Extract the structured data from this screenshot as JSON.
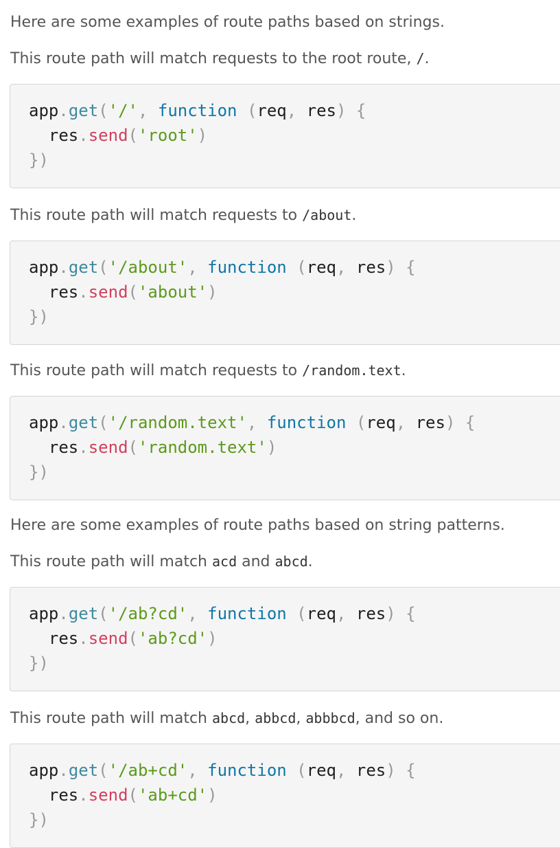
{
  "paragraphs": {
    "intro_strings": "Here are some examples of route paths based on strings.",
    "root_desc_prefix": "This route path will match requests to the root route, ",
    "root_desc_code": "/",
    "root_desc_suffix": ".",
    "about_desc_prefix": "This route path will match requests to ",
    "about_desc_code": "/about",
    "about_desc_suffix": ".",
    "random_desc_prefix": "This route path will match requests to ",
    "random_desc_code": "/random.text",
    "random_desc_suffix": ".",
    "intro_patterns": "Here are some examples of route paths based on string patterns.",
    "acd_desc_prefix": "This route path will match ",
    "acd_desc_code1": "acd",
    "acd_desc_mid": " and ",
    "acd_desc_code2": "abcd",
    "acd_desc_suffix": ".",
    "plus_desc_prefix": "This route path will match ",
    "plus_desc_code1": "abcd",
    "plus_desc_sep1": ", ",
    "plus_desc_code2": "abbcd",
    "plus_desc_sep2": ", ",
    "plus_desc_code3": "abbbcd",
    "plus_desc_suffix": ", and so on."
  },
  "code": {
    "obj": "app",
    "dot": ".",
    "get": "get",
    "open_paren": "(",
    "comma": ", ",
    "function_kw": "function",
    "space": " ",
    "params_open": "(",
    "req": "req",
    "params_comma": ", ",
    "res": "res",
    "params_close": ")",
    "brace_open": "{",
    "indent": "  ",
    "send": "send",
    "close_paren": ")",
    "block_close": "})",
    "blocks": [
      {
        "path": "'/'",
        "response": "'root'"
      },
      {
        "path": "'/about'",
        "response": "'about'"
      },
      {
        "path": "'/random.text'",
        "response": "'random.text'"
      },
      {
        "path": "'/ab?cd'",
        "response": "'ab?cd'"
      },
      {
        "path": "'/ab+cd'",
        "response": "'ab+cd'"
      }
    ]
  },
  "colors": {
    "text": "#555555",
    "code_keyword": "#0f77a8",
    "code_string": "#5b9a1a",
    "code_method": "#d23f5e",
    "code_function_name": "#3e8a9c",
    "code_punctuation": "#999999",
    "code_background": "#f5f5f5"
  }
}
